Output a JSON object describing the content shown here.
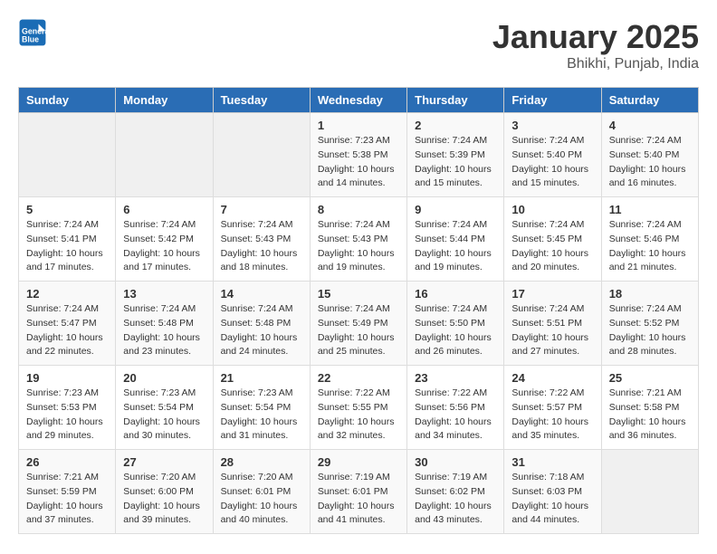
{
  "header": {
    "logo_line1": "General",
    "logo_line2": "Blue",
    "title": "January 2025",
    "subtitle": "Bhikhi, Punjab, India"
  },
  "columns": [
    "Sunday",
    "Monday",
    "Tuesday",
    "Wednesday",
    "Thursday",
    "Friday",
    "Saturday"
  ],
  "weeks": [
    [
      {
        "day": "",
        "sunrise": "",
        "sunset": "",
        "daylight": ""
      },
      {
        "day": "",
        "sunrise": "",
        "sunset": "",
        "daylight": ""
      },
      {
        "day": "",
        "sunrise": "",
        "sunset": "",
        "daylight": ""
      },
      {
        "day": "1",
        "sunrise": "7:23 AM",
        "sunset": "5:38 PM",
        "daylight": "10 hours and 14 minutes."
      },
      {
        "day": "2",
        "sunrise": "7:24 AM",
        "sunset": "5:39 PM",
        "daylight": "10 hours and 15 minutes."
      },
      {
        "day": "3",
        "sunrise": "7:24 AM",
        "sunset": "5:40 PM",
        "daylight": "10 hours and 15 minutes."
      },
      {
        "day": "4",
        "sunrise": "7:24 AM",
        "sunset": "5:40 PM",
        "daylight": "10 hours and 16 minutes."
      }
    ],
    [
      {
        "day": "5",
        "sunrise": "7:24 AM",
        "sunset": "5:41 PM",
        "daylight": "10 hours and 17 minutes."
      },
      {
        "day": "6",
        "sunrise": "7:24 AM",
        "sunset": "5:42 PM",
        "daylight": "10 hours and 17 minutes."
      },
      {
        "day": "7",
        "sunrise": "7:24 AM",
        "sunset": "5:43 PM",
        "daylight": "10 hours and 18 minutes."
      },
      {
        "day": "8",
        "sunrise": "7:24 AM",
        "sunset": "5:43 PM",
        "daylight": "10 hours and 19 minutes."
      },
      {
        "day": "9",
        "sunrise": "7:24 AM",
        "sunset": "5:44 PM",
        "daylight": "10 hours and 19 minutes."
      },
      {
        "day": "10",
        "sunrise": "7:24 AM",
        "sunset": "5:45 PM",
        "daylight": "10 hours and 20 minutes."
      },
      {
        "day": "11",
        "sunrise": "7:24 AM",
        "sunset": "5:46 PM",
        "daylight": "10 hours and 21 minutes."
      }
    ],
    [
      {
        "day": "12",
        "sunrise": "7:24 AM",
        "sunset": "5:47 PM",
        "daylight": "10 hours and 22 minutes."
      },
      {
        "day": "13",
        "sunrise": "7:24 AM",
        "sunset": "5:48 PM",
        "daylight": "10 hours and 23 minutes."
      },
      {
        "day": "14",
        "sunrise": "7:24 AM",
        "sunset": "5:48 PM",
        "daylight": "10 hours and 24 minutes."
      },
      {
        "day": "15",
        "sunrise": "7:24 AM",
        "sunset": "5:49 PM",
        "daylight": "10 hours and 25 minutes."
      },
      {
        "day": "16",
        "sunrise": "7:24 AM",
        "sunset": "5:50 PM",
        "daylight": "10 hours and 26 minutes."
      },
      {
        "day": "17",
        "sunrise": "7:24 AM",
        "sunset": "5:51 PM",
        "daylight": "10 hours and 27 minutes."
      },
      {
        "day": "18",
        "sunrise": "7:24 AM",
        "sunset": "5:52 PM",
        "daylight": "10 hours and 28 minutes."
      }
    ],
    [
      {
        "day": "19",
        "sunrise": "7:23 AM",
        "sunset": "5:53 PM",
        "daylight": "10 hours and 29 minutes."
      },
      {
        "day": "20",
        "sunrise": "7:23 AM",
        "sunset": "5:54 PM",
        "daylight": "10 hours and 30 minutes."
      },
      {
        "day": "21",
        "sunrise": "7:23 AM",
        "sunset": "5:54 PM",
        "daylight": "10 hours and 31 minutes."
      },
      {
        "day": "22",
        "sunrise": "7:22 AM",
        "sunset": "5:55 PM",
        "daylight": "10 hours and 32 minutes."
      },
      {
        "day": "23",
        "sunrise": "7:22 AM",
        "sunset": "5:56 PM",
        "daylight": "10 hours and 34 minutes."
      },
      {
        "day": "24",
        "sunrise": "7:22 AM",
        "sunset": "5:57 PM",
        "daylight": "10 hours and 35 minutes."
      },
      {
        "day": "25",
        "sunrise": "7:21 AM",
        "sunset": "5:58 PM",
        "daylight": "10 hours and 36 minutes."
      }
    ],
    [
      {
        "day": "26",
        "sunrise": "7:21 AM",
        "sunset": "5:59 PM",
        "daylight": "10 hours and 37 minutes."
      },
      {
        "day": "27",
        "sunrise": "7:20 AM",
        "sunset": "6:00 PM",
        "daylight": "10 hours and 39 minutes."
      },
      {
        "day": "28",
        "sunrise": "7:20 AM",
        "sunset": "6:01 PM",
        "daylight": "10 hours and 40 minutes."
      },
      {
        "day": "29",
        "sunrise": "7:19 AM",
        "sunset": "6:01 PM",
        "daylight": "10 hours and 41 minutes."
      },
      {
        "day": "30",
        "sunrise": "7:19 AM",
        "sunset": "6:02 PM",
        "daylight": "10 hours and 43 minutes."
      },
      {
        "day": "31",
        "sunrise": "7:18 AM",
        "sunset": "6:03 PM",
        "daylight": "10 hours and 44 minutes."
      },
      {
        "day": "",
        "sunrise": "",
        "sunset": "",
        "daylight": ""
      }
    ]
  ]
}
